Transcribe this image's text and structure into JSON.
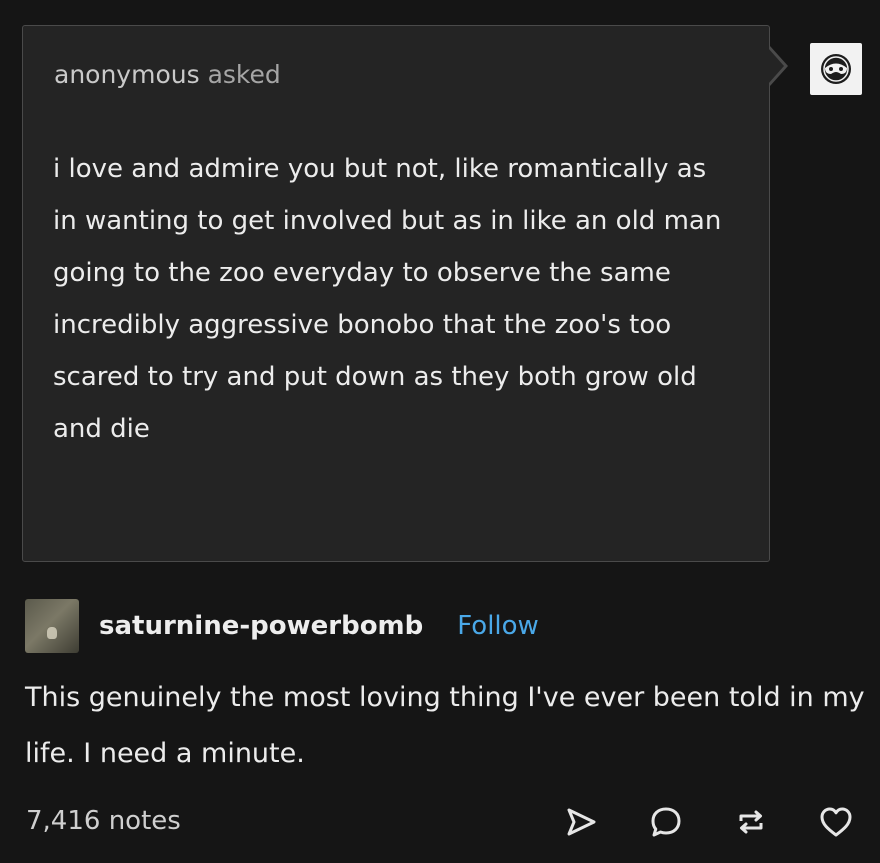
{
  "ask": {
    "asker_name": "anonymous",
    "asked_label": "asked",
    "question": "i love and admire you but not, like romantically as in wanting to get involved but as in like an old man going to the zoo everyday to observe the same incredibly aggressive bonobo that the zoo's too scared to try and put down as they both grow old and die"
  },
  "post": {
    "blog_name": "saturnine-powerbomb",
    "follow_label": "Follow",
    "reply_text": "This genuinely the most loving thing I've ever been told in my life. I need a minute.",
    "notes_count": "7,416 notes"
  },
  "icons": {
    "anon_avatar": "anonymous-mask-icon",
    "share": "share-icon",
    "reply": "reply-bubble-icon",
    "reblog": "reblog-icon",
    "like": "heart-icon"
  },
  "colors": {
    "background": "#151515",
    "ask_box": "#242424",
    "follow_link": "#4aa8e8"
  }
}
